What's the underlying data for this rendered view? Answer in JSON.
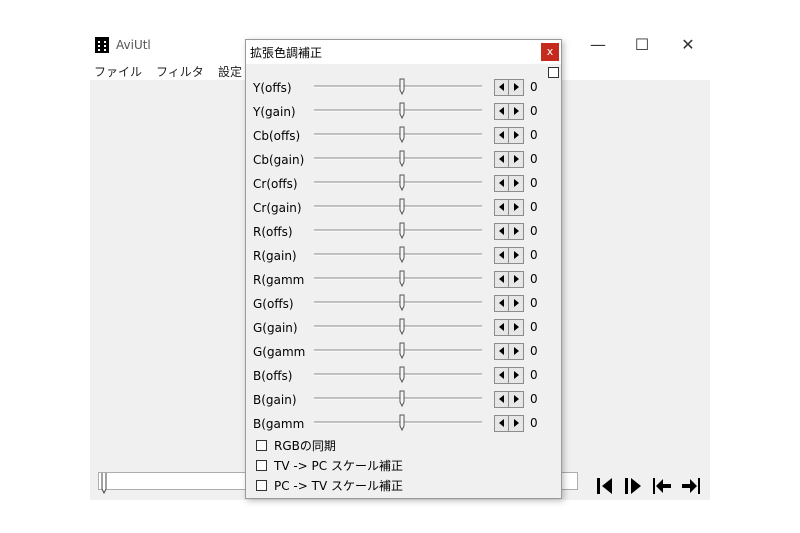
{
  "main_window": {
    "title": "AviUtl",
    "minimize": "—",
    "maximize": "☐",
    "close": "✕",
    "menu": [
      "ファイル",
      "フィルタ",
      "設定"
    ]
  },
  "dialog": {
    "title": "拡張色調補正",
    "close_label": "x",
    "enabled": false,
    "rows": [
      {
        "label": "Y(offs)",
        "value": "0"
      },
      {
        "label": "Y(gain)",
        "value": "0"
      },
      {
        "label": "Cb(offs)",
        "value": "0"
      },
      {
        "label": "Cb(gain)",
        "value": "0"
      },
      {
        "label": "Cr(offs)",
        "value": "0"
      },
      {
        "label": "Cr(gain)",
        "value": "0"
      },
      {
        "label": "R(offs)",
        "value": "0"
      },
      {
        "label": "R(gain)",
        "value": "0"
      },
      {
        "label": "R(gamma)",
        "value": "0"
      },
      {
        "label": "G(offs)",
        "value": "0"
      },
      {
        "label": "G(gain)",
        "value": "0"
      },
      {
        "label": "G(gamma)",
        "value": "0"
      },
      {
        "label": "B(offs)",
        "value": "0"
      },
      {
        "label": "B(gain)",
        "value": "0"
      },
      {
        "label": "B(gamma)",
        "value": "0"
      }
    ],
    "options": [
      {
        "label": "RGBの同期",
        "checked": false
      },
      {
        "label": "TV -> PC スケール補正",
        "checked": false
      },
      {
        "label": "PC -> TV スケール補正",
        "checked": false
      }
    ]
  },
  "colors": {
    "close_red": "#c42b1c",
    "panel_bg": "#f0f0f0"
  }
}
